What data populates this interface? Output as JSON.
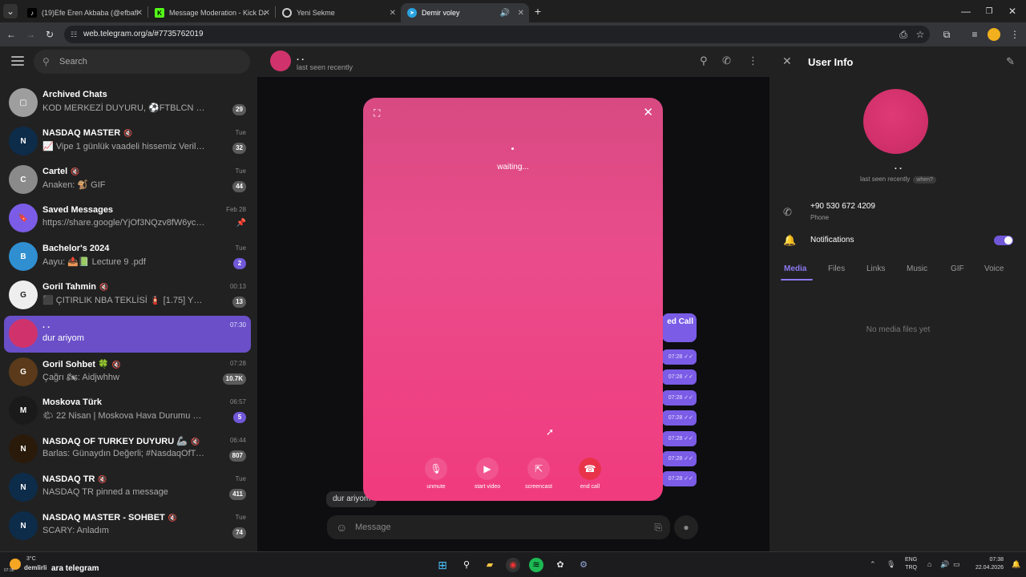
{
  "browser": {
    "tabs": [
      {
        "title": "(19)Efe Eren Akbaba (@efbafi) |",
        "favicon": "tiktok-icon"
      },
      {
        "title": "Message Moderation - Kick Da",
        "favicon": "kick-icon"
      },
      {
        "title": "Yeni Sekme",
        "favicon": "chrome-icon"
      },
      {
        "title": "Demir voley",
        "favicon": "telegram-icon"
      }
    ],
    "url": "web.telegram.org/a/#7735762019"
  },
  "sidebar": {
    "search_placeholder": "Search",
    "chats": [
      {
        "name": "Archived Chats",
        "message": "KOD MERKEZİ DUYURU, ⚽FTBLCN SOHBET, K...",
        "time": "",
        "badge": "29",
        "avatar_color": "#9e9e9e",
        "avatar_text": "▢"
      },
      {
        "name": "NASDAQ MASTER",
        "muted": true,
        "message": "📈 Vipe 1 günlük vaadeli hissemiz Verildi Min...",
        "time": "Tue",
        "badge": "32",
        "avatar_color": "#0d2c4a",
        "avatar_text": "N"
      },
      {
        "name": "Cartel",
        "muted": true,
        "message": "Anaken: 🐒 GIF",
        "time": "Tue",
        "badge": "44",
        "avatar_color": "#8a8a8a",
        "avatar_text": "C"
      },
      {
        "name": "Saved Messages",
        "message": "https://share.google/YjOf3NQzv8fW6ycpm",
        "time": "Feb 28",
        "badge": "",
        "pinned": true,
        "avatar_color": "#7b5ce6",
        "avatar_text": "🔖"
      },
      {
        "name": "Bachelor's 2024",
        "message": "Aayu: 📤📗 Lecture 9 .pdf",
        "time": "Tue",
        "badge": "2",
        "badge_blue": true,
        "avatar_color": "#2f8fd1",
        "avatar_text": "B"
      },
      {
        "name": "Goril Tahmin",
        "muted": true,
        "message": "⬛ ÇITIRLIK NBA TEKLİSİ 🧯 [1.75] Yüksek or...",
        "time": "00:13",
        "badge": "13",
        "avatar_color": "#eeeeee",
        "avatar_text": "G"
      },
      {
        "name": ". .",
        "message": "dur ariyom",
        "time": "07:30",
        "badge": "",
        "selected": true,
        "avatar_color": "#d0336b",
        "avatar_text": ""
      },
      {
        "name": "Goril Sohbet 🍀",
        "muted": true,
        "message": "Çağrı 🏍: Aidjwhhw",
        "time": "07:28",
        "badge": "10.7K",
        "avatar_color": "#5a3a1a",
        "avatar_text": "G"
      },
      {
        "name": "Moskova Türk",
        "message": "🌤 22 Nisan | Moskova Hava Durumu Sabah gü...",
        "time": "06:57",
        "badge": "5",
        "badge_blue": true,
        "avatar_color": "#1a1a1a",
        "avatar_text": "M"
      },
      {
        "name": "NASDAQ OF TURKEY DUYURU 🦾",
        "muted": true,
        "message": "Barlas: Günaydın Değerli; #NasdaqOfTurkey ...",
        "time": "06:44",
        "badge": "807",
        "avatar_color": "#2a1a0a",
        "avatar_text": "N"
      },
      {
        "name": "NASDAQ TR",
        "muted": true,
        "message": "NASDAQ TR pinned a message",
        "time": "Tue",
        "badge": "411",
        "avatar_color": "#0d2c4a",
        "avatar_text": "N"
      },
      {
        "name": "NASDAQ MASTER - SOHBET",
        "muted": true,
        "message": "SCARY: Anladım",
        "time": "Tue",
        "badge": "74",
        "avatar_color": "#0d2c4a",
        "avatar_text": "N"
      }
    ]
  },
  "chat": {
    "name": ". .",
    "status": "last seen recently",
    "bubble_title": "ed Call",
    "bubble_times": [
      "07:28",
      "07:28",
      "07:28",
      "07:28",
      "07:28",
      "07:28",
      "07:28"
    ],
    "last_message": "dur ariyom",
    "composer_placeholder": "Message"
  },
  "call": {
    "status": "waiting...",
    "buttons": [
      {
        "label": "unmute",
        "icon": "microphone-icon"
      },
      {
        "label": "start video",
        "icon": "video-camera-icon"
      },
      {
        "label": "screencast",
        "icon": "screencast-icon"
      },
      {
        "label": "end call",
        "icon": "hangup-icon"
      }
    ]
  },
  "user_info": {
    "title": "User Info",
    "name": ". .",
    "status": "last seen recently",
    "when": "when?",
    "phone": "+90 530 672 4209",
    "phone_label": "Phone",
    "notifications_label": "Notifications",
    "notifications_on": true,
    "tabs": [
      "Media",
      "Files",
      "Links",
      "Music",
      "GIF",
      "Voice"
    ],
    "active_tab": "Media",
    "empty_text": "No media files yet"
  },
  "taskbar": {
    "temperature": "3°C",
    "weather_text": "demlirli",
    "search_text": "ara telegram",
    "time_small": "07:38",
    "lang_top": "ENG",
    "lang_bottom": "TRQ",
    "clock_time": "07:38",
    "clock_date": "22.04.2026"
  }
}
